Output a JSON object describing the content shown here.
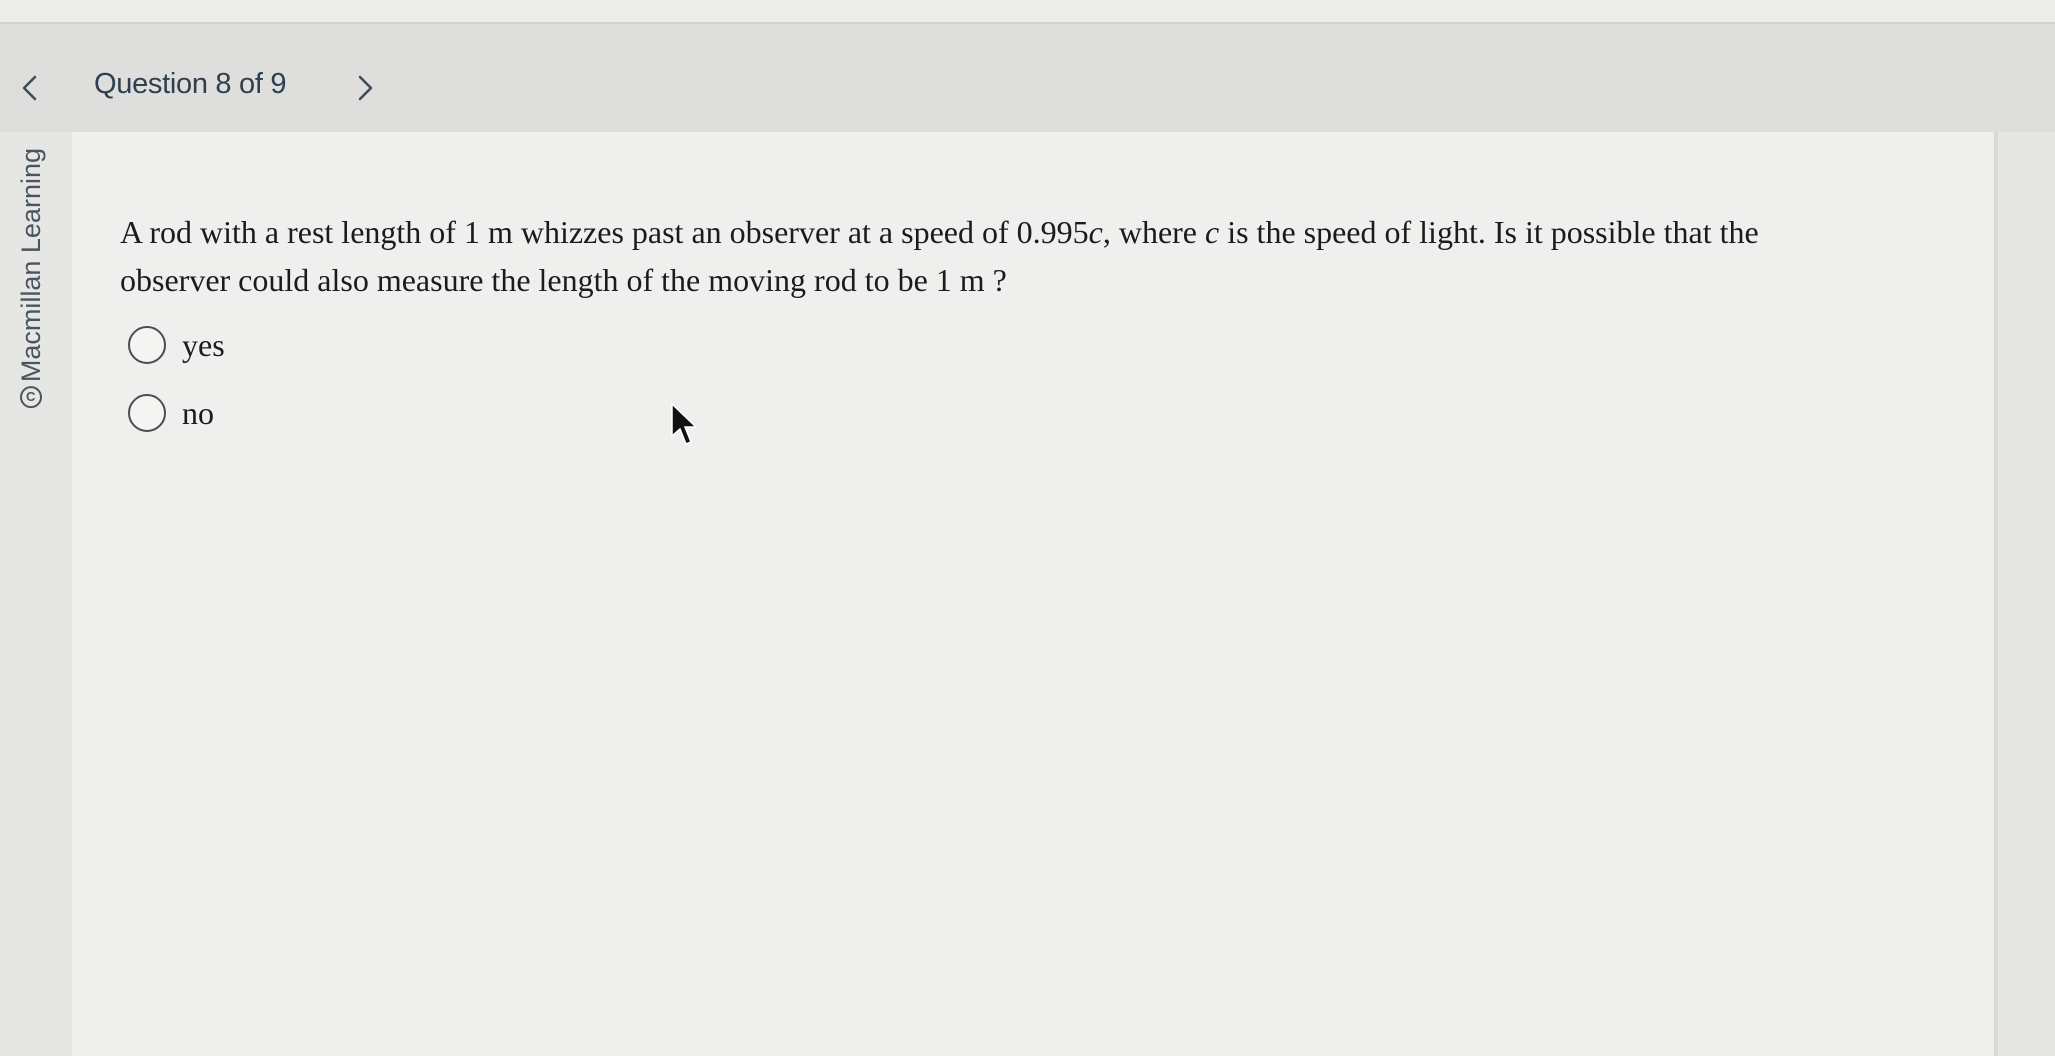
{
  "header": {
    "prev_icon": "chevron-left-icon",
    "title": "Question 8 of 9",
    "next_icon": "chevron-right-icon"
  },
  "brand": {
    "copyright_icon": "copyright-icon",
    "name": "Macmillan Learning"
  },
  "question": {
    "part1": "A rod with a rest length of 1 m whizzes past an observer at a speed of 0.995",
    "var1": "c",
    "part2": ", where ",
    "var2": "c",
    "part3": " is the speed of light. Is it possible that the observer could also measure the length of the moving rod to be 1 m ?"
  },
  "options": [
    {
      "label": "yes",
      "selected": false
    },
    {
      "label": "no",
      "selected": false
    }
  ],
  "colors": {
    "background": "#e6e6e4",
    "panel": "#efefed",
    "header_text": "#2f3f4f"
  }
}
